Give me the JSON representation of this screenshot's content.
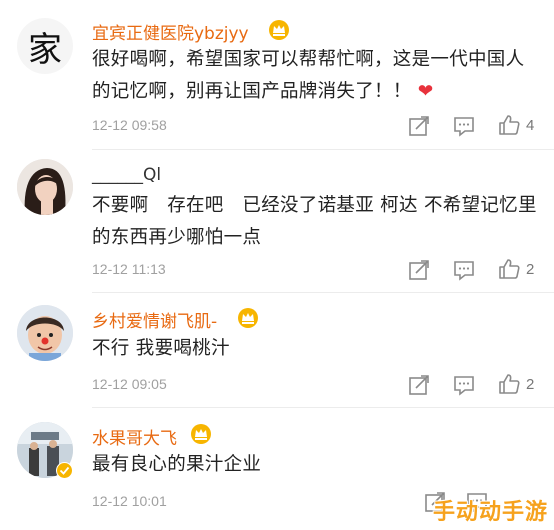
{
  "comments": [
    {
      "avatar_char": "家",
      "username": "宜宾正健医院ybzjyy",
      "content": "很好喝啊，希望国家可以帮帮忙啊，这是一代中国人的记忆啊，别再让国产品牌消失了！！",
      "heart": "❤",
      "time": "12-12 09:58",
      "likes": "4"
    },
    {
      "username": "______Ql",
      "content": "不要啊　存在吧　已经没了诺基亚 柯达 不希望记忆里的东西再少哪怕一点",
      "time": "12-12 11:13",
      "likes": "2"
    },
    {
      "username": "乡村爱情谢飞肌-",
      "content": "不行 我要喝桃汁",
      "time": "12-12 09:05",
      "likes": "2"
    },
    {
      "username": "水果哥大飞",
      "content": "最有良心的果汁企业",
      "time": "12-12 10:01",
      "likes": ""
    }
  ],
  "icons": {
    "share": "share-icon",
    "comment": "comment-icon",
    "like": "thumbs-up-icon",
    "badge": "crown-badge-icon"
  },
  "colors": {
    "username": "#e86a12",
    "heart": "#e8323c",
    "watermark": "#f6a21d"
  },
  "watermark": "手动动手游"
}
